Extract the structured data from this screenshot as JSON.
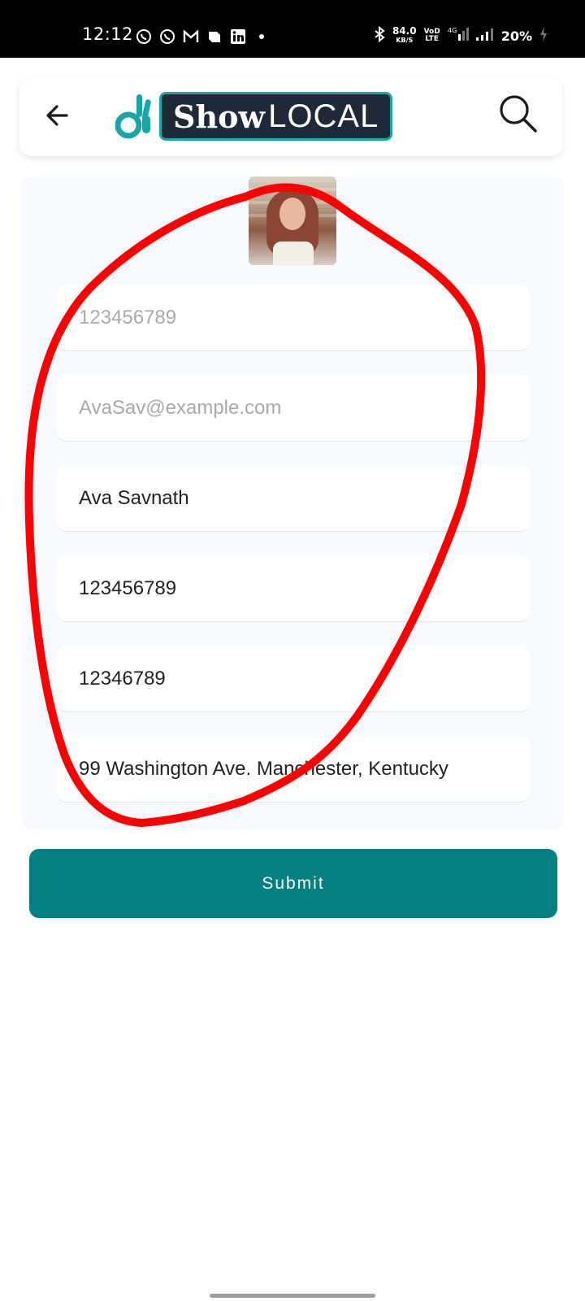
{
  "status_bar": {
    "time": "12:12",
    "net_speed": "84.0",
    "net_unit": "KB/S",
    "volte_top": "VoD",
    "volte_bottom": "LTE",
    "network": "4G",
    "battery": "20%",
    "app_icons": [
      "whatsapp-icon",
      "whatsapp-business-icon",
      "gmail-icon",
      "chat-icon",
      "linkedin-icon"
    ]
  },
  "header": {
    "logo_show": "Show",
    "logo_local": "LOCAL"
  },
  "form": {
    "fields": [
      {
        "value": "123456789",
        "is_placeholder": true
      },
      {
        "value": "AvaSav@example.com",
        "is_placeholder": true
      },
      {
        "value": "Ava Savnath",
        "is_placeholder": false
      },
      {
        "value": "123456789",
        "is_placeholder": false
      },
      {
        "value": "12346789",
        "is_placeholder": false
      },
      {
        "value": "99 Washington Ave. Manchester, Kentucky",
        "is_placeholder": false
      }
    ],
    "submit_label": "Submit"
  },
  "colors": {
    "accent": "#067f82",
    "logo_teal": "#17a6a6",
    "annotation": "#ff0000"
  }
}
